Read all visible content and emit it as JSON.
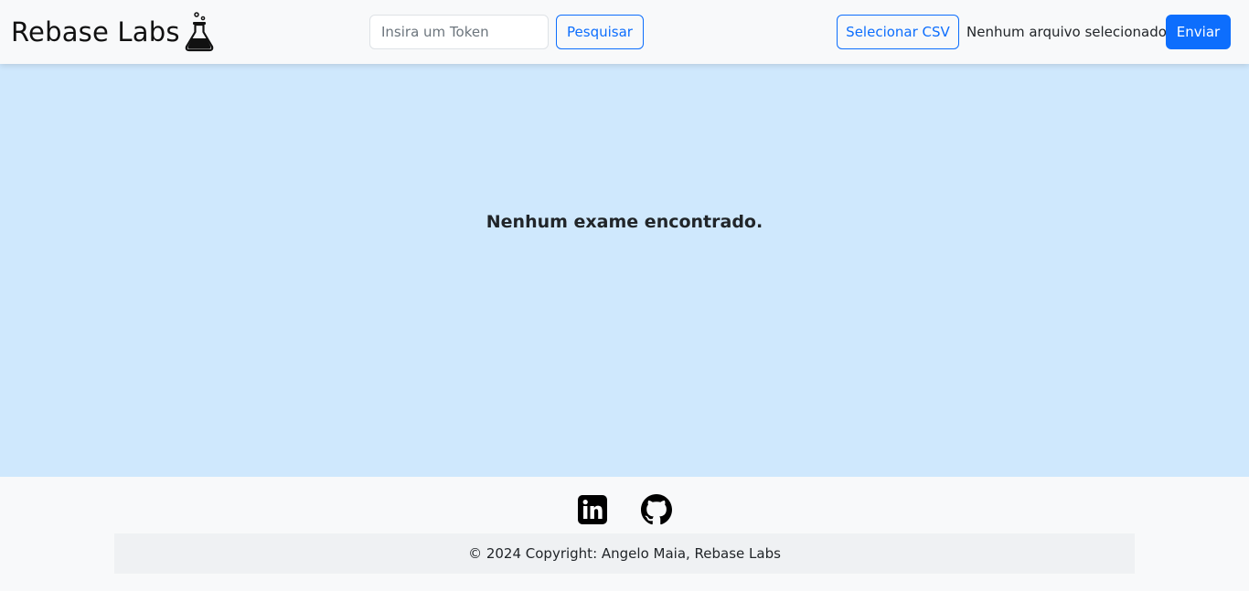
{
  "header": {
    "brand_name": "Rebase Labs",
    "brand_icon": "flask-icon",
    "search": {
      "placeholder": "Insira um Token",
      "value": "",
      "button_label": "Pesquisar"
    },
    "upload": {
      "select_label": "Selecionar CSV",
      "file_status": "Nenhum arquivo selecionado",
      "send_label": "Enviar"
    }
  },
  "main": {
    "empty_message": "Nenhum exame encontrado."
  },
  "footer": {
    "social_icons": [
      "linkedin-icon",
      "github-icon"
    ],
    "copyright": "© 2024 Copyright: Angelo Maia, Rebase Labs"
  },
  "colors": {
    "primary": "#0d6efd",
    "main_background": "#cfe8fd",
    "navbar_background": "#f8f9fa",
    "copyright_background": "#eff1f3"
  }
}
